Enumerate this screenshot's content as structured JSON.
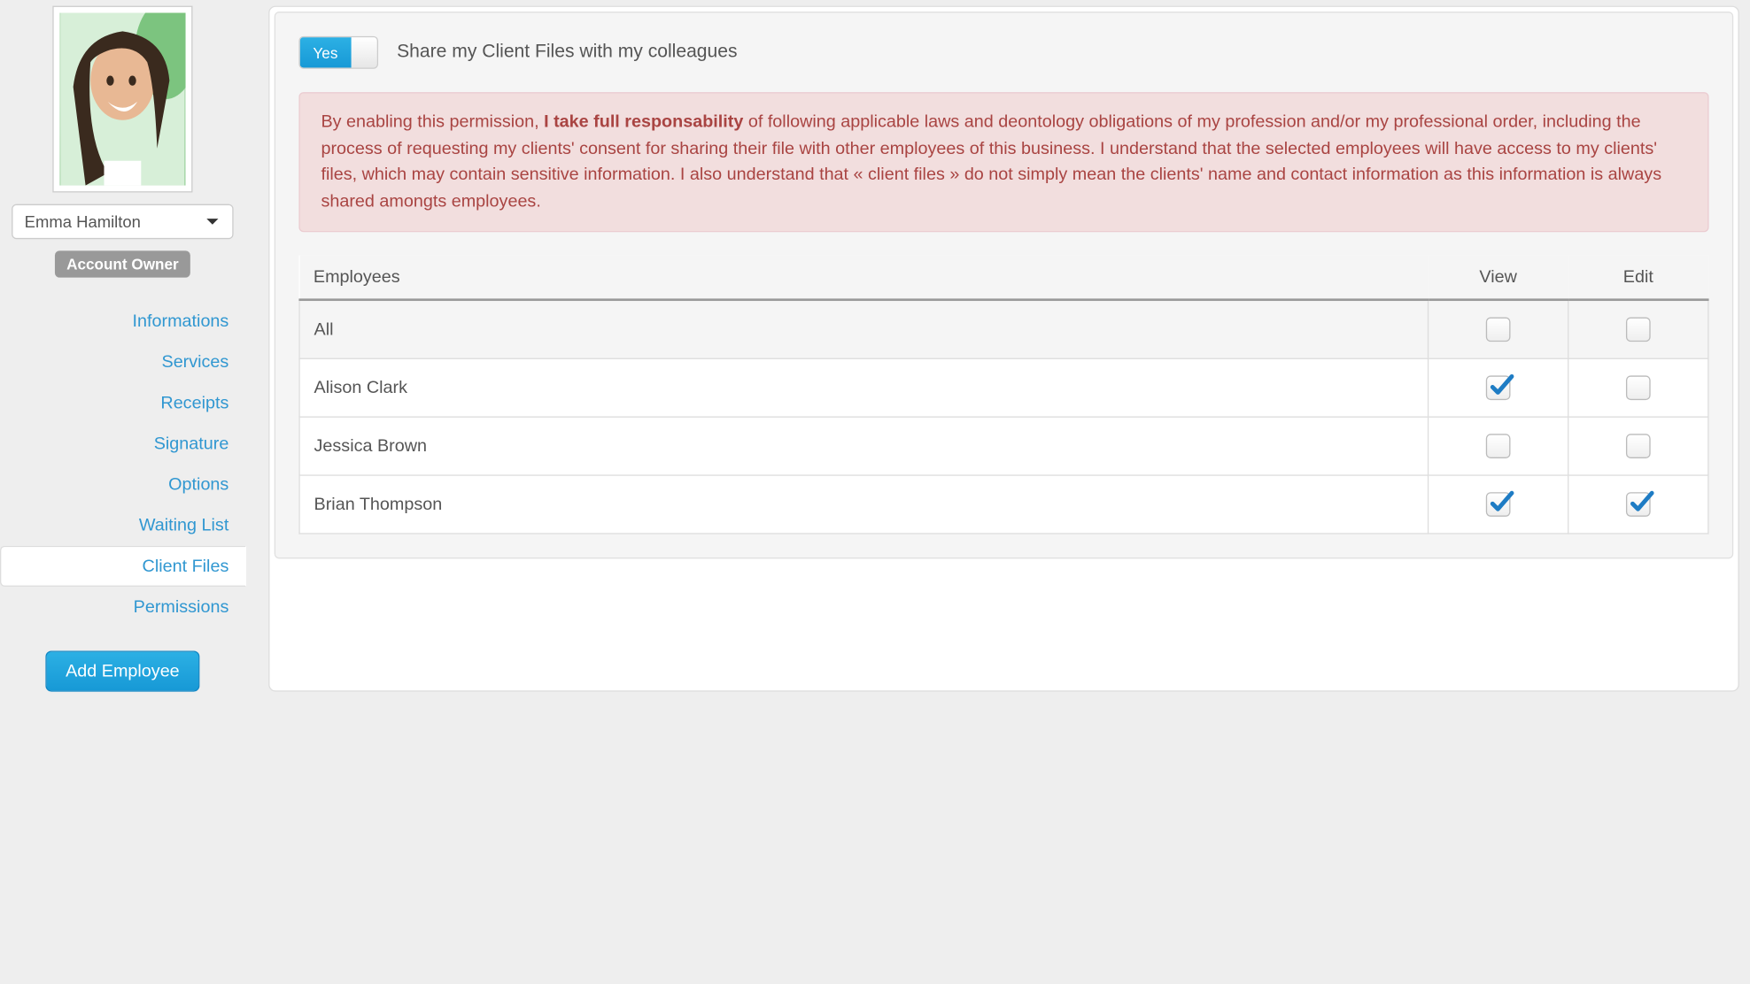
{
  "sidebar": {
    "user_name": "Emma Hamilton",
    "owner_badge": "Account Owner",
    "nav": [
      {
        "label": "Informations",
        "active": false
      },
      {
        "label": "Services",
        "active": false
      },
      {
        "label": "Receipts",
        "active": false
      },
      {
        "label": "Signature",
        "active": false
      },
      {
        "label": "Options",
        "active": false
      },
      {
        "label": "Waiting List",
        "active": false
      },
      {
        "label": "Client Files",
        "active": true
      },
      {
        "label": "Permissions",
        "active": false
      }
    ],
    "add_button": "Add Employee"
  },
  "main": {
    "toggle": {
      "value": "Yes",
      "label": "Share my Client Files with my colleagues"
    },
    "alert": {
      "pre": "By enabling this permission, ",
      "bold": "I take full responsability",
      "post": " of following applicable laws and deontology obligations of my profession and/or my professional order, including the process of requesting my clients' consent for sharing their file with other employees of this business. I understand that the selected employees will have access to my clients' files, which may contain sensitive information. I also understand that « client files » do not simply mean the clients' name and contact information as this information is always shared amongts employees."
    },
    "table": {
      "headers": {
        "employees": "Employees",
        "view": "View",
        "edit": "Edit"
      },
      "rows": [
        {
          "name": "All",
          "view": false,
          "edit": false,
          "all": true
        },
        {
          "name": "Alison Clark",
          "view": true,
          "edit": false
        },
        {
          "name": "Jessica Brown",
          "view": false,
          "edit": false
        },
        {
          "name": "Brian Thompson",
          "view": true,
          "edit": true
        }
      ]
    }
  }
}
